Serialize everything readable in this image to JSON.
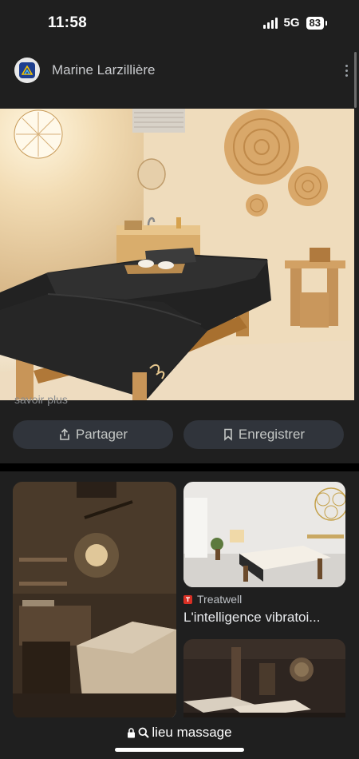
{
  "status_bar": {
    "time": "11:58",
    "network": "5G",
    "battery": "83"
  },
  "pin": {
    "author": "Marine Larzillière",
    "truncated_text": "savoir plus",
    "share_label": "Partager",
    "save_label": "Enregistrer"
  },
  "related": {
    "source": "Treatwell",
    "title": "L'intelligence vibratoi..."
  },
  "search": {
    "query": "lieu massage"
  },
  "colors": {
    "background": "#1f1f1f",
    "pill": "#30343b",
    "source_badge": "#d93025"
  },
  "icons": [
    "avatar-logo-icon",
    "more-options-icon",
    "share-icon",
    "bookmark-icon",
    "treatwell-icon",
    "lock-icon",
    "search-icon"
  ]
}
